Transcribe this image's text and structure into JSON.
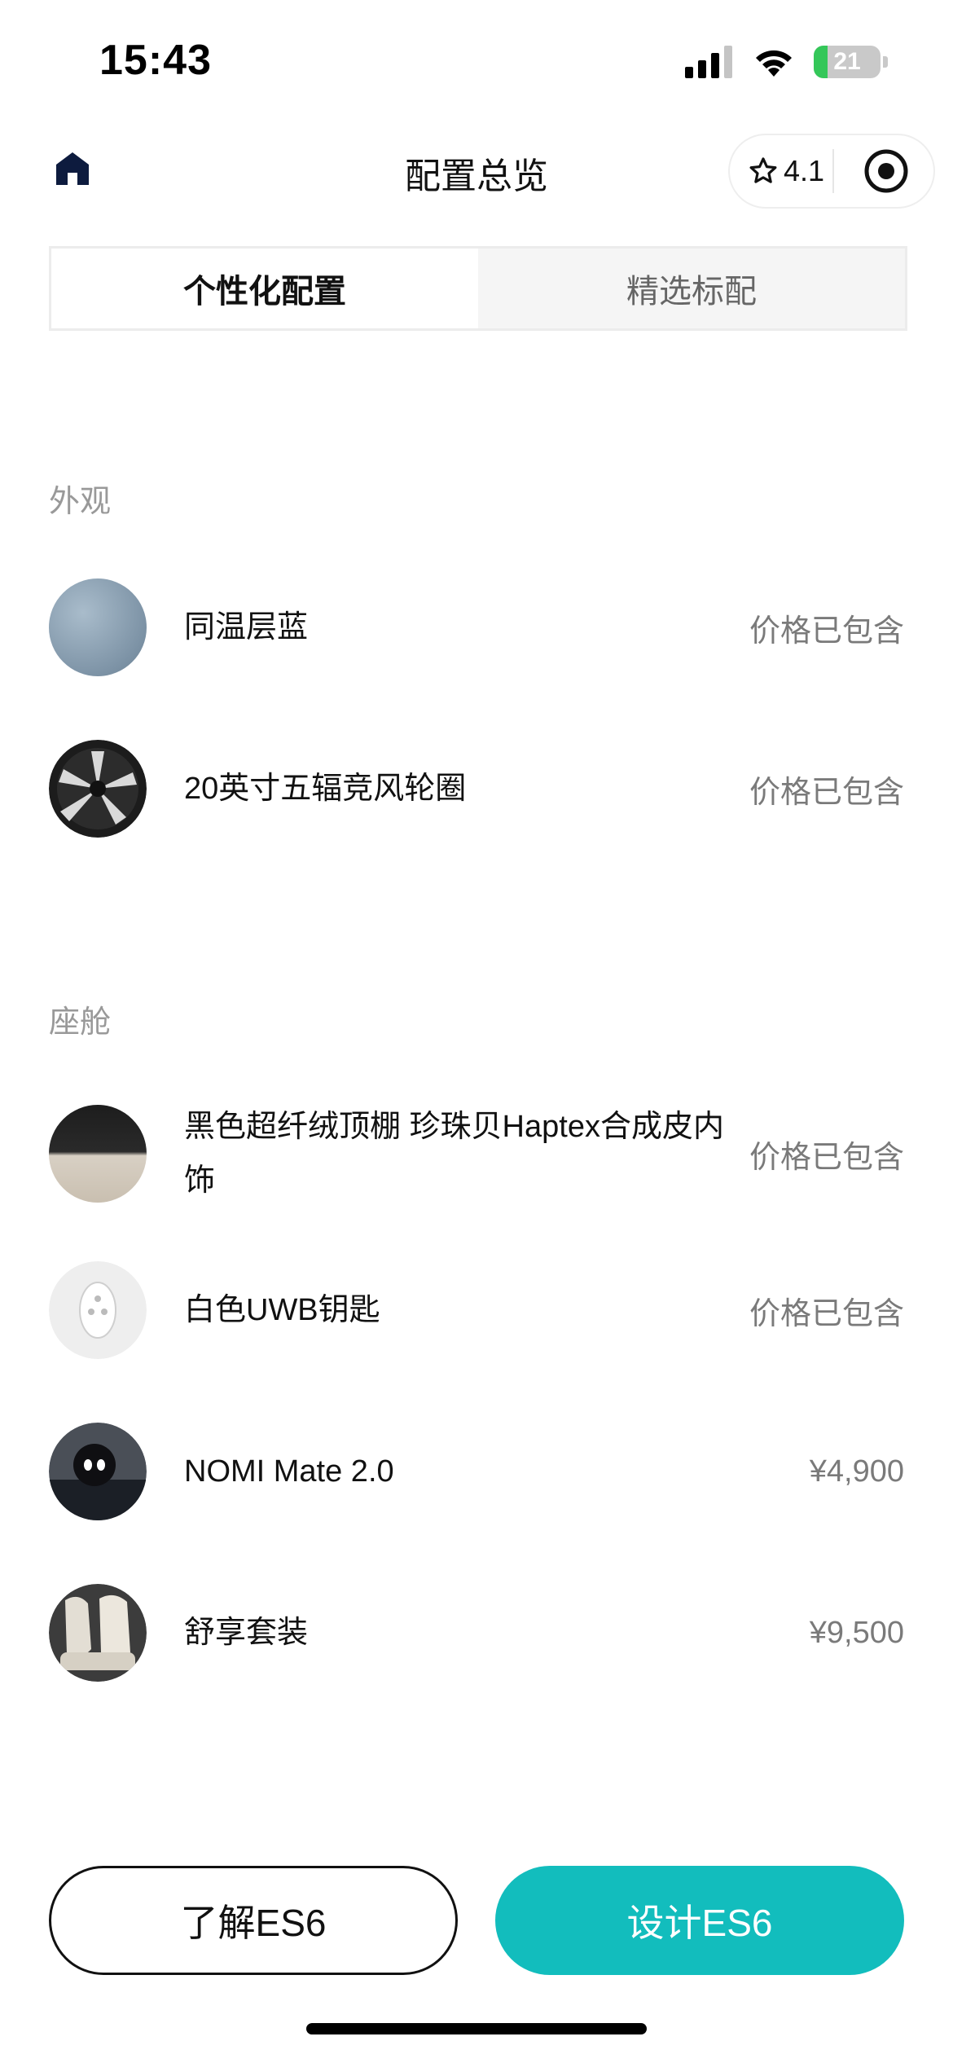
{
  "status_bar": {
    "time": "15:43",
    "battery": "21",
    "battery_level": 0.21
  },
  "nav": {
    "title": "配置总览",
    "rating": "4.1",
    "icons": [
      "home-icon",
      "star-icon",
      "target-icon"
    ]
  },
  "tabs": [
    {
      "label": "个性化配置",
      "active": true
    },
    {
      "label": "精选标配",
      "active": false
    }
  ],
  "sections": {
    "exterior": {
      "label": "外观",
      "items": [
        {
          "name": "同温层蓝",
          "price": "价格已包含",
          "thumb": "stratosphere-blue-swatch"
        },
        {
          "name": "20英寸五辐竞风轮圈",
          "price": "价格已包含",
          "thumb": "wheel-rim-image"
        }
      ]
    },
    "cabin": {
      "label": "座舱",
      "items": [
        {
          "name": "黑色超纤绒顶棚 珍珠贝Haptex合成皮内饰",
          "price": "价格已包含",
          "thumb": "interior-swatch"
        },
        {
          "name": "白色UWB钥匙",
          "price": "价格已包含",
          "thumb": "uwb-key-image"
        },
        {
          "name": "NOMI Mate 2.0",
          "price": "¥4,900",
          "thumb": "nomi-mate-image"
        },
        {
          "name": "舒享套装",
          "price": "¥9,500",
          "thumb": "comfort-seats-image"
        }
      ]
    }
  },
  "buttons": {
    "learn": "了解ES6",
    "design": "设计ES6"
  },
  "colors": {
    "accent": "#12bdbd",
    "home_icon": "#0d1b3e",
    "battery_green": "#34c759"
  }
}
